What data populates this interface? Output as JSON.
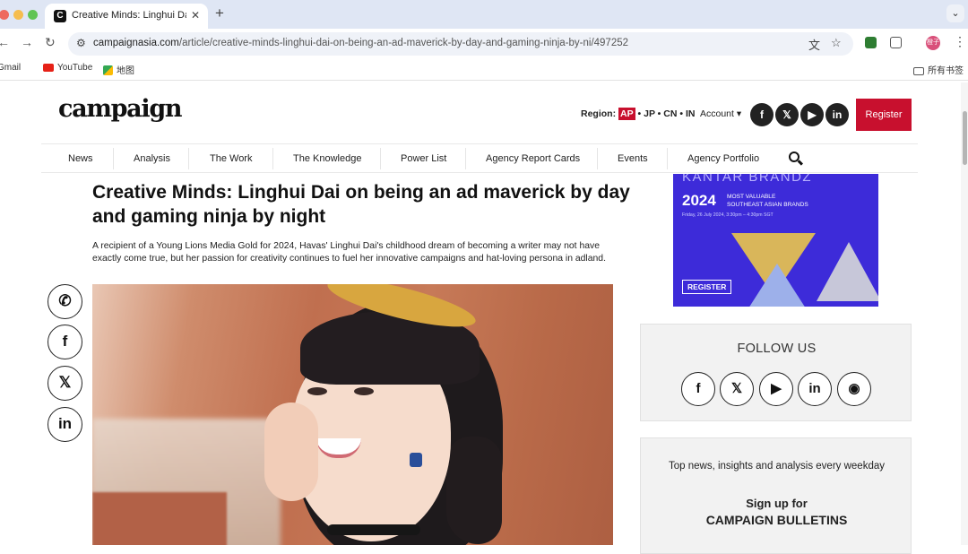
{
  "browser": {
    "tab_title": "Creative Minds: Linghui Dai o",
    "tab_favicon": "C",
    "url_host": "campaignasia.com",
    "url_path": "/article/creative-minds-linghui-dai-on-being-an-ad-maverick-by-day-and-gaming-ninja-by-ni/497252",
    "profile_label": "橙子",
    "bookmarks": [
      "Gmail",
      "YouTube",
      "地图"
    ],
    "all_bookmarks": "所有书签"
  },
  "site": {
    "logo": "campaign",
    "region_label": "Region:",
    "region_active": "AP",
    "region_others": "• JP • CN • IN",
    "account": "Account ▾",
    "register": "Register",
    "social": [
      "f",
      "𝕏",
      "▶",
      "in"
    ]
  },
  "nav": [
    "News",
    "Analysis",
    "The Work",
    "The Knowledge",
    "Power List",
    "Agency Report Cards",
    "Events",
    "Agency Portfolio"
  ],
  "article": {
    "headline": "Creative Minds: Linghui Dai on being an ad maverick by day and gaming ninja by night",
    "standfirst": "A recipient of a Young Lions Media Gold for 2024, Havas' Linghui Dai's childhood dream of becoming a writer may not have exactly come true, but her passion for creativity continues to fuel her innovative campaigns and hat-loving persona in adland."
  },
  "share": [
    "✆",
    "f",
    "𝕏",
    "in"
  ],
  "ad": {
    "brand": "KANTAR BRANDZ",
    "year": "2024",
    "tagline_1": "MOST VALUABLE",
    "tagline_2": "SOUTHEAST ASIAN BRANDS",
    "date": "Friday, 26 July 2024, 3:30pm – 4:30pm SGT",
    "cta": "REGISTER"
  },
  "follow": {
    "title": "FOLLOW US",
    "icons": [
      "f",
      "𝕏",
      "▶",
      "in",
      "◉"
    ]
  },
  "newsletter": {
    "top": "Top news, insights and analysis every weekday",
    "sign_up": "Sign up for",
    "title": "CAMPAIGN BULLETINS"
  }
}
